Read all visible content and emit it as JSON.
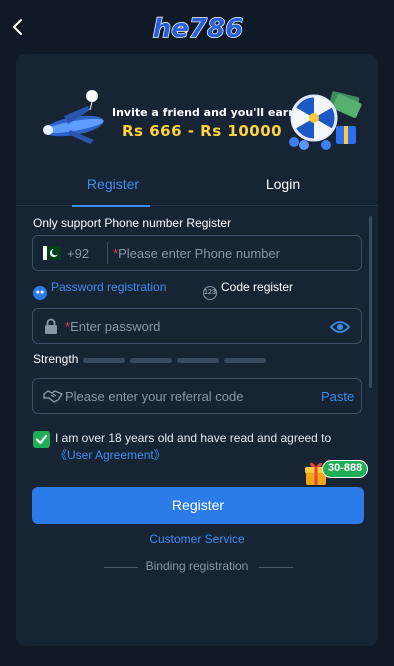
{
  "header": {
    "brand": "he786"
  },
  "banner": {
    "line1": "Invite a friend and you'll earn",
    "line2": "Rs 666 - Rs 10000"
  },
  "tabs": [
    {
      "label": "Register",
      "active": true
    },
    {
      "label": "Login",
      "active": false
    }
  ],
  "form": {
    "phone_only_notice": "Only support Phone number Register",
    "country_code": "+92",
    "phone_placeholder": "Please enter Phone number",
    "required_mark": "*",
    "options": {
      "password_registration": "Password registration",
      "code_register": "Code register",
      "code_icon_text": "123"
    },
    "password_placeholder": "Enter password",
    "strength_label": "Strength",
    "strength_level": 0,
    "referral_placeholder": "Please enter your referral code",
    "paste_label": "Paste",
    "agree_checked": true,
    "agree_text": "I am over 18 years old and have read and agreed to ",
    "agree_link": "《User Agreement》",
    "gift_badge": "30-888",
    "register_button": "Register",
    "customer_service": "Customer Service",
    "binding_registration": "Binding registration"
  },
  "colors": {
    "background": "#101a26",
    "card": "#172434",
    "accent": "#3d8ef0",
    "button": "#2b7ce8",
    "success": "#1fae55",
    "gold": "#ffd23c"
  },
  "icons": [
    "back-icon",
    "plane-icon",
    "wheel-icon",
    "flag-icon",
    "dot-icon",
    "code-icon",
    "lock-icon",
    "eye-icon",
    "handshake-icon",
    "check-icon",
    "gift-icon"
  ]
}
